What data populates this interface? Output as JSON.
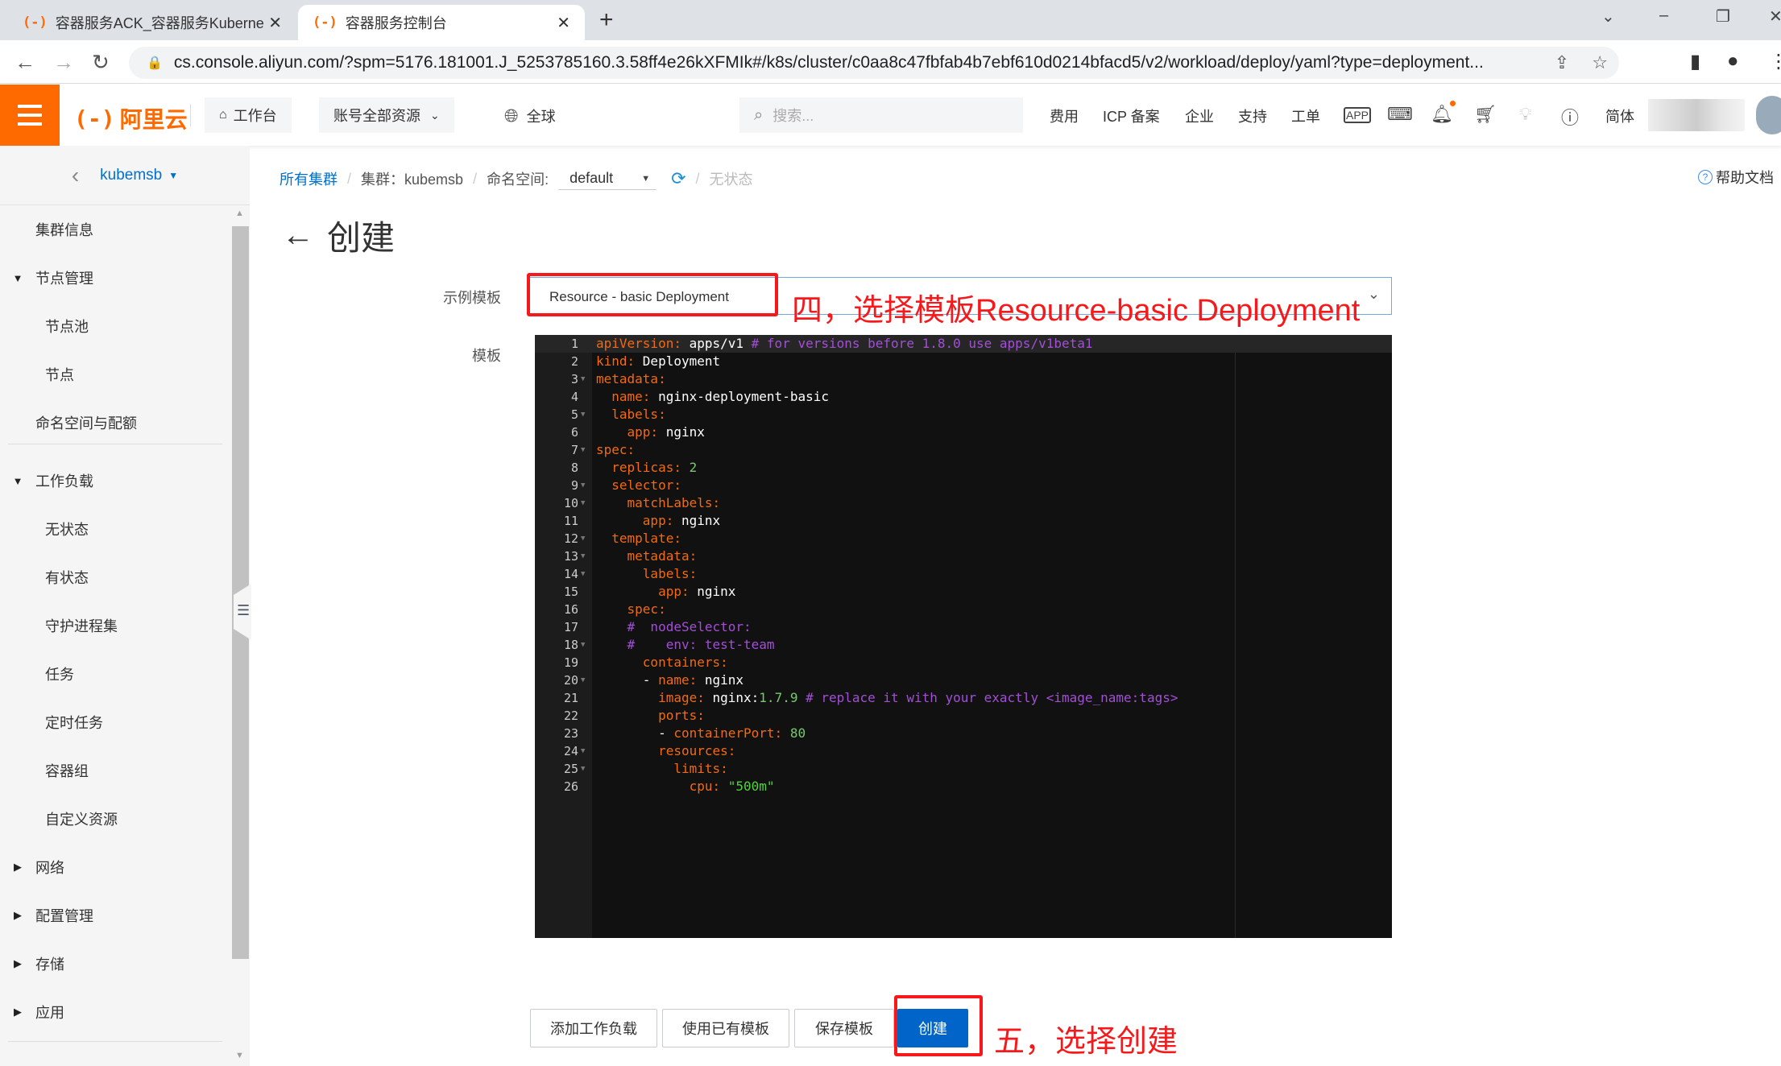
{
  "browser": {
    "tabs": [
      {
        "title": "容器服务ACK_容器服务Kubernetes",
        "active": false
      },
      {
        "title": "容器服务控制台",
        "active": true
      }
    ],
    "new_tab_label": "+",
    "url": "cs.console.aliyun.com/?spm=5176.181001.J_5253785160.3.58ff4e26kXFMIk#/k8s/cluster/c0aa8c47fbfab4b7ebf610d0214bfacd5/v2/workload/deploy/yaml?type=deployment..."
  },
  "header": {
    "logo_mark": "(-)",
    "logo_text": "阿里云",
    "workbench": "工作台",
    "account_resources": "账号全部资源",
    "region": "全球",
    "search_placeholder": "搜索...",
    "links": [
      "费用",
      "ICP 备案",
      "企业",
      "支持",
      "工单"
    ],
    "language": "简体",
    "notification_dot_color": "#ff6a00"
  },
  "sidebar": {
    "cluster_name": "kubemsb",
    "items": [
      {
        "label": "集群信息",
        "level": 0,
        "expander": ""
      },
      {
        "label": "节点管理",
        "level": 0,
        "expander": "▼"
      },
      {
        "label": "节点池",
        "level": 1,
        "expander": ""
      },
      {
        "label": "节点",
        "level": 1,
        "expander": ""
      },
      {
        "label": "命名空间与配额",
        "level": 0,
        "expander": ""
      },
      {
        "label": "工作负载",
        "level": 0,
        "expander": "▼"
      },
      {
        "label": "无状态",
        "level": 1,
        "expander": ""
      },
      {
        "label": "有状态",
        "level": 1,
        "expander": ""
      },
      {
        "label": "守护进程集",
        "level": 1,
        "expander": ""
      },
      {
        "label": "任务",
        "level": 1,
        "expander": ""
      },
      {
        "label": "定时任务",
        "level": 1,
        "expander": ""
      },
      {
        "label": "容器组",
        "level": 1,
        "expander": ""
      },
      {
        "label": "自定义资源",
        "level": 1,
        "expander": ""
      },
      {
        "label": "网络",
        "level": 0,
        "expander": "▶"
      },
      {
        "label": "配置管理",
        "level": 0,
        "expander": "▶"
      },
      {
        "label": "存储",
        "level": 0,
        "expander": "▶"
      },
      {
        "label": "应用",
        "level": 0,
        "expander": "▶"
      }
    ]
  },
  "breadcrumb": {
    "all_clusters": "所有集群",
    "cluster": "集群：kubemsb",
    "namespace_label": "命名空间:",
    "namespace_value": "default",
    "current": "无状态"
  },
  "help_docs": "帮助文档",
  "page_title": "创建",
  "form": {
    "sample_template_label": "示例模板",
    "sample_template_value": "Resource - basic Deployment",
    "template_label": "模板"
  },
  "editor": {
    "lines": [
      {
        "n": 1,
        "fold": false,
        "active": true,
        "tokens": [
          [
            "k",
            "apiVersion: "
          ],
          [
            "v",
            "apps/v1 "
          ],
          [
            "c",
            "# for versions before 1.8.0 use apps/v1beta1"
          ]
        ]
      },
      {
        "n": 2,
        "fold": false,
        "tokens": [
          [
            "k",
            "kind: "
          ],
          [
            "v",
            "Deployment"
          ]
        ]
      },
      {
        "n": 3,
        "fold": true,
        "tokens": [
          [
            "k",
            "metadata:"
          ]
        ]
      },
      {
        "n": 4,
        "fold": false,
        "tokens": [
          [
            "v",
            "  "
          ],
          [
            "k",
            "name: "
          ],
          [
            "v",
            "nginx-deployment-basic"
          ]
        ]
      },
      {
        "n": 5,
        "fold": true,
        "tokens": [
          [
            "v",
            "  "
          ],
          [
            "k",
            "labels:"
          ]
        ]
      },
      {
        "n": 6,
        "fold": false,
        "tokens": [
          [
            "v",
            "    "
          ],
          [
            "k",
            "app: "
          ],
          [
            "v",
            "nginx"
          ]
        ]
      },
      {
        "n": 7,
        "fold": true,
        "tokens": [
          [
            "k",
            "spec:"
          ]
        ]
      },
      {
        "n": 8,
        "fold": false,
        "tokens": [
          [
            "v",
            "  "
          ],
          [
            "k",
            "replicas: "
          ],
          [
            "n",
            "2"
          ]
        ]
      },
      {
        "n": 9,
        "fold": true,
        "tokens": [
          [
            "v",
            "  "
          ],
          [
            "k",
            "selector:"
          ]
        ]
      },
      {
        "n": 10,
        "fold": true,
        "tokens": [
          [
            "v",
            "    "
          ],
          [
            "k",
            "matchLabels:"
          ]
        ]
      },
      {
        "n": 11,
        "fold": false,
        "tokens": [
          [
            "v",
            "      "
          ],
          [
            "k",
            "app: "
          ],
          [
            "v",
            "nginx"
          ]
        ]
      },
      {
        "n": 12,
        "fold": true,
        "tokens": [
          [
            "v",
            "  "
          ],
          [
            "k",
            "template:"
          ]
        ]
      },
      {
        "n": 13,
        "fold": true,
        "tokens": [
          [
            "v",
            "    "
          ],
          [
            "k",
            "metadata:"
          ]
        ]
      },
      {
        "n": 14,
        "fold": true,
        "tokens": [
          [
            "v",
            "      "
          ],
          [
            "k",
            "labels:"
          ]
        ]
      },
      {
        "n": 15,
        "fold": false,
        "tokens": [
          [
            "v",
            "        "
          ],
          [
            "k",
            "app: "
          ],
          [
            "v",
            "nginx"
          ]
        ]
      },
      {
        "n": 16,
        "fold": false,
        "tokens": [
          [
            "v",
            "    "
          ],
          [
            "k",
            "spec:"
          ]
        ]
      },
      {
        "n": 17,
        "fold": false,
        "tokens": [
          [
            "v",
            "    "
          ],
          [
            "c",
            "#  nodeSelector:"
          ]
        ]
      },
      {
        "n": 18,
        "fold": true,
        "tokens": [
          [
            "v",
            "    "
          ],
          [
            "c",
            "#    env: test-team"
          ]
        ]
      },
      {
        "n": 19,
        "fold": false,
        "tokens": [
          [
            "v",
            "      "
          ],
          [
            "k",
            "containers:"
          ]
        ]
      },
      {
        "n": 20,
        "fold": true,
        "tokens": [
          [
            "v",
            "      - "
          ],
          [
            "k",
            "name: "
          ],
          [
            "v",
            "nginx"
          ]
        ]
      },
      {
        "n": 21,
        "fold": false,
        "tokens": [
          [
            "v",
            "        "
          ],
          [
            "k",
            "image: "
          ],
          [
            "v",
            "nginx:"
          ],
          [
            "n",
            "1.7.9 "
          ],
          [
            "c",
            "# replace it with your exactly <image_name:tags>"
          ]
        ]
      },
      {
        "n": 22,
        "fold": false,
        "tokens": [
          [
            "v",
            "        "
          ],
          [
            "k",
            "ports:"
          ]
        ]
      },
      {
        "n": 23,
        "fold": false,
        "tokens": [
          [
            "v",
            "        - "
          ],
          [
            "k",
            "containerPort: "
          ],
          [
            "n",
            "80"
          ]
        ]
      },
      {
        "n": 24,
        "fold": true,
        "tokens": [
          [
            "v",
            "        "
          ],
          [
            "k",
            "resources:"
          ]
        ]
      },
      {
        "n": 25,
        "fold": true,
        "tokens": [
          [
            "v",
            "          "
          ],
          [
            "k",
            "limits:"
          ]
        ]
      },
      {
        "n": 26,
        "fold": false,
        "tokens": [
          [
            "v",
            "            "
          ],
          [
            "k",
            "cpu: "
          ],
          [
            "s",
            "\"500m\""
          ]
        ]
      }
    ]
  },
  "buttons": {
    "add_workload": "添加工作负载",
    "use_existing_template": "使用已有模板",
    "save_template": "保存模板",
    "create": "创建"
  },
  "annotations": {
    "step4": "四，选择模板Resource-basic Deployment",
    "step5": "五，选择创建",
    "color": "#f5191c"
  }
}
